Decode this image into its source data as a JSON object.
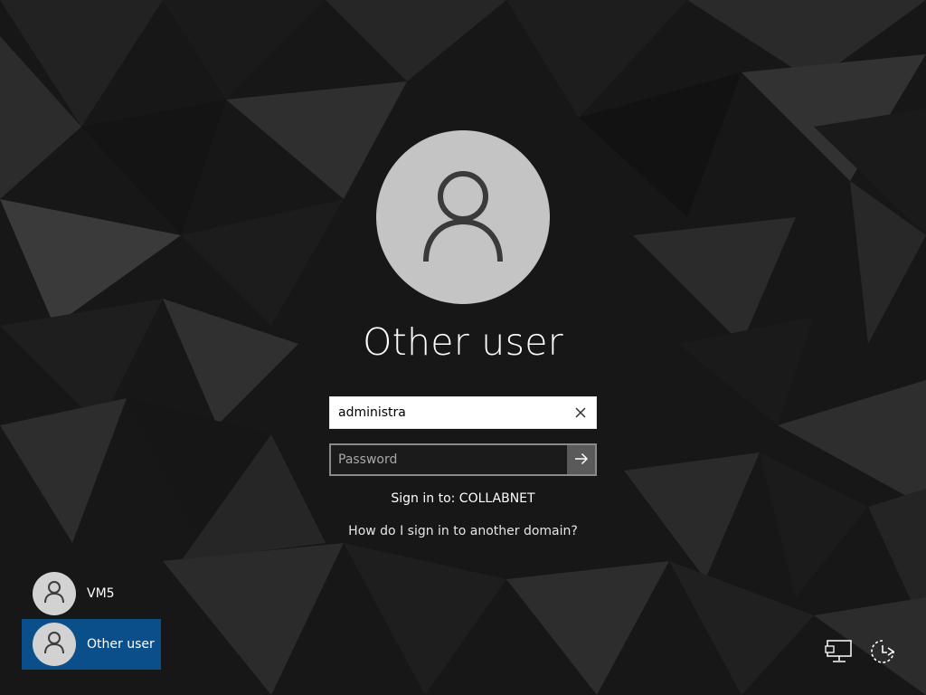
{
  "login": {
    "display_name": "Other user",
    "username_value": "administra",
    "password_placeholder": "Password",
    "sign_in_to": "Sign in to: COLLABNET",
    "help_link": "How do I sign in to another domain?"
  },
  "user_list": [
    {
      "name": "VM5",
      "selected": false
    },
    {
      "name": "Other user",
      "selected": true
    }
  ],
  "icons": {
    "avatar": "user-silhouette-icon",
    "clear": "close-icon",
    "submit": "arrow-right-icon",
    "network": "network-icon",
    "power": "power-icon"
  },
  "colors": {
    "background": "#151515",
    "selected_user": "#0b4f8a",
    "avatar": "#c4c4c4",
    "submit_button": "#5a5a5a"
  }
}
